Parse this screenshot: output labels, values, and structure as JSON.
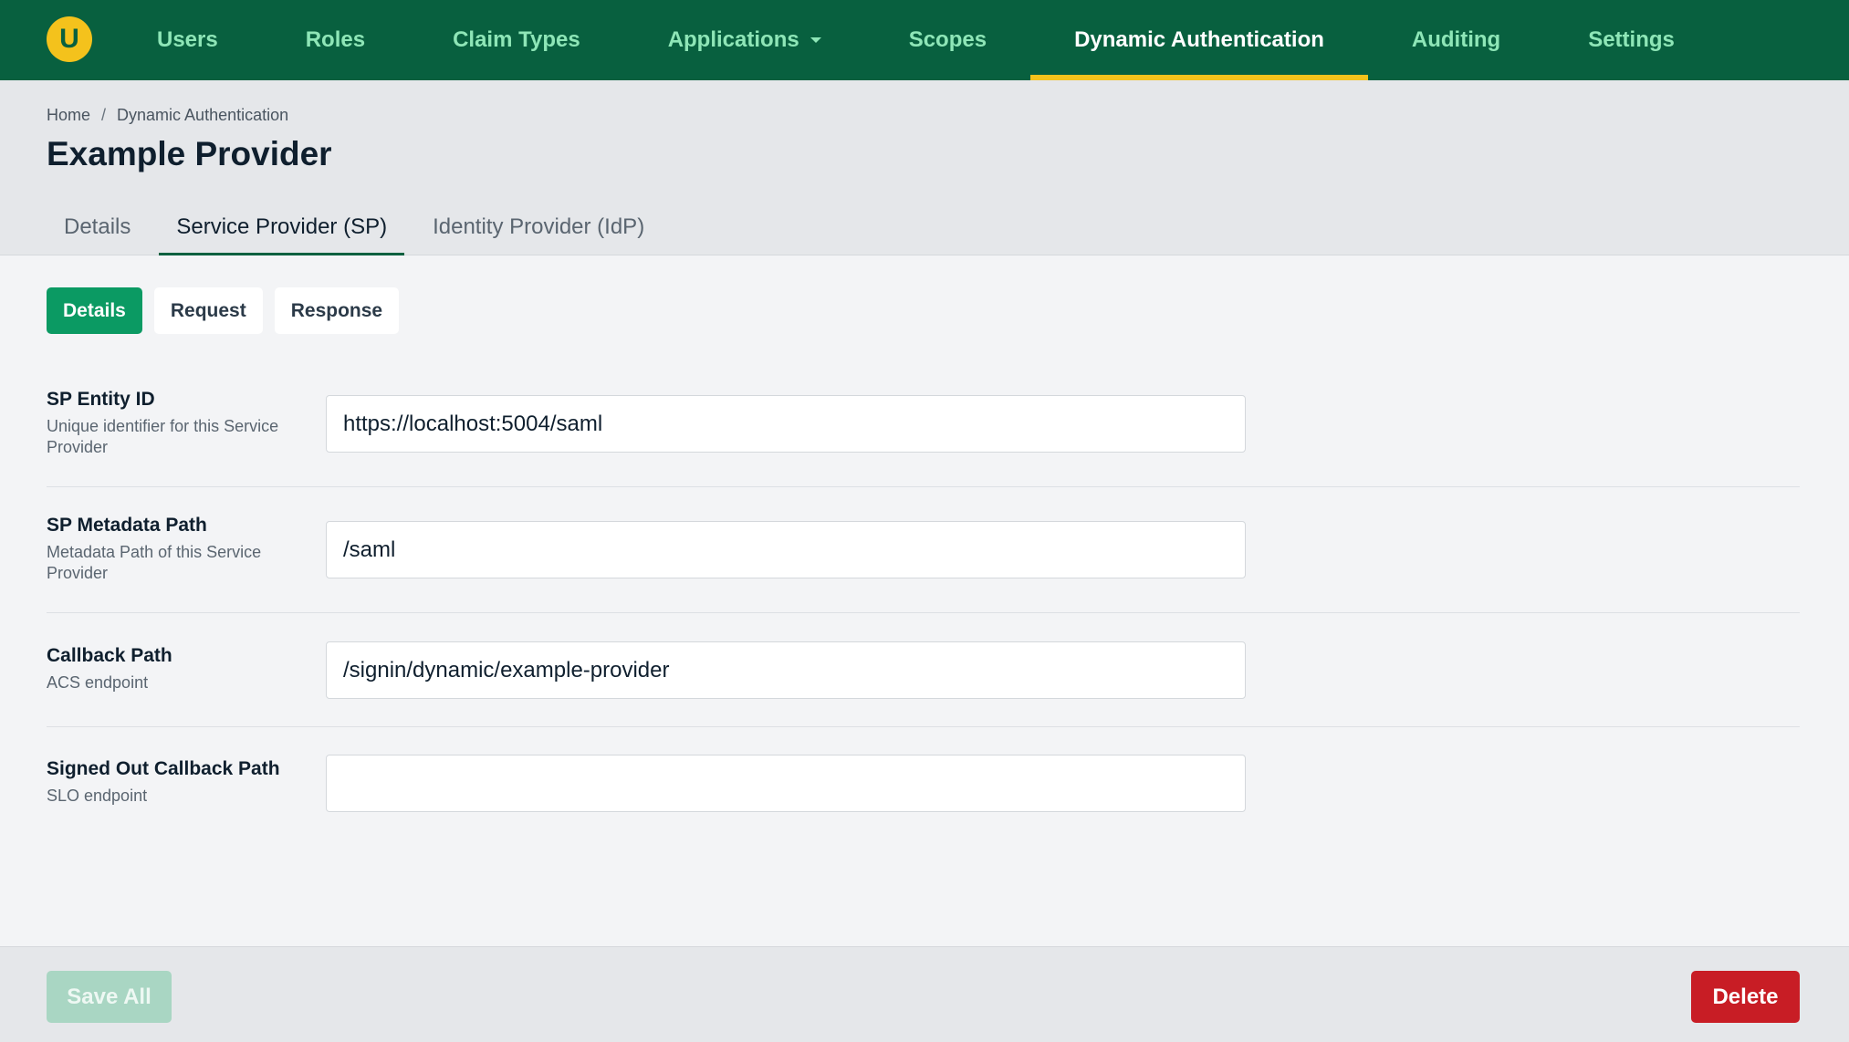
{
  "nav": {
    "logo_letter": "U",
    "items": [
      {
        "label": "Users",
        "active": false
      },
      {
        "label": "Roles",
        "active": false
      },
      {
        "label": "Claim Types",
        "active": false
      },
      {
        "label": "Applications",
        "active": false,
        "has_dropdown": true
      },
      {
        "label": "Scopes",
        "active": false
      },
      {
        "label": "Dynamic Authentication",
        "active": true
      },
      {
        "label": "Auditing",
        "active": false
      },
      {
        "label": "Settings",
        "active": false
      }
    ]
  },
  "breadcrumb": [
    "Home",
    "Dynamic Authentication"
  ],
  "breadcrumb_separator": "/",
  "page_title": "Example Provider",
  "tabs": [
    {
      "label": "Details",
      "active": false
    },
    {
      "label": "Service Provider (SP)",
      "active": true
    },
    {
      "label": "Identity Provider (IdP)",
      "active": false
    }
  ],
  "subtabs": [
    {
      "label": "Details",
      "active": true
    },
    {
      "label": "Request",
      "active": false
    },
    {
      "label": "Response",
      "active": false
    }
  ],
  "fields": [
    {
      "label": "SP Entity ID",
      "description": "Unique identifier for this Service Provider",
      "value": "https://localhost:5004/saml"
    },
    {
      "label": "SP Metadata Path",
      "description": "Metadata Path of this Service Provider",
      "value": "/saml"
    },
    {
      "label": "Callback Path",
      "description": "ACS endpoint",
      "value": "/signin/dynamic/example-provider"
    },
    {
      "label": "Signed Out Callback Path",
      "description": "SLO endpoint",
      "value": ""
    }
  ],
  "footer": {
    "save_label": "Save All",
    "delete_label": "Delete"
  },
  "colors": {
    "nav_bg": "#08603f",
    "accent_yellow": "#f4c21c",
    "primary_green": "#0b9a63",
    "danger_red": "#c81d25"
  }
}
